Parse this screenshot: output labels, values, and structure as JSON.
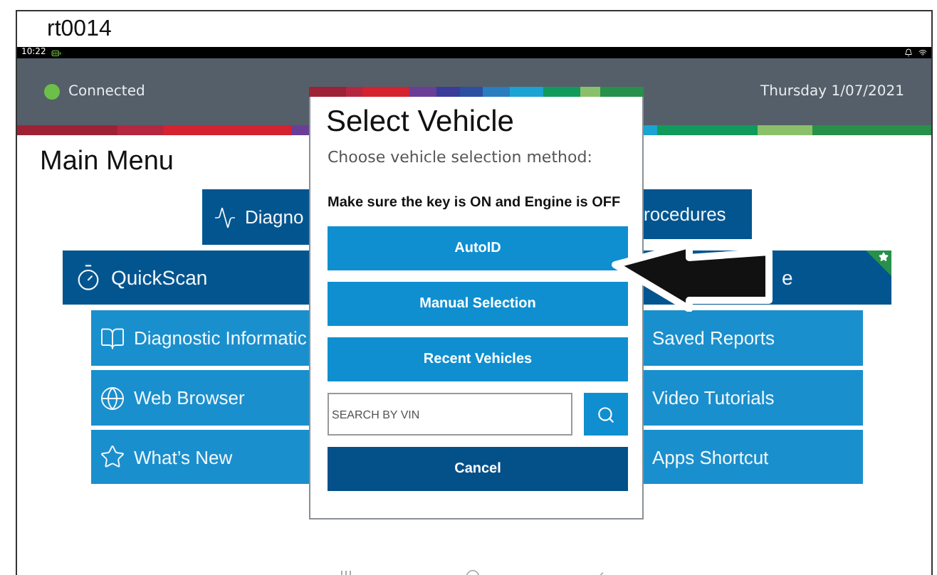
{
  "window": {
    "title": "rt0014"
  },
  "status_bar": {
    "time": "10:22"
  },
  "header": {
    "connection": {
      "label": "Connected",
      "connected": true
    },
    "date": "Thursday 1/07/2021"
  },
  "main_menu": {
    "title": "Main Menu",
    "rows": [
      {
        "tiles": [
          {
            "label": "Diagno",
            "kind": "primary",
            "new": false
          },
          {
            "label": "rocedures",
            "kind": "primary",
            "new": false
          }
        ]
      },
      {
        "tiles": [
          {
            "label": "QuickScan",
            "kind": "primary",
            "new": false
          },
          {
            "label": "e",
            "kind": "primary",
            "new": true
          }
        ]
      },
      {
        "tiles": [
          {
            "label": "Diagnostic Informatic",
            "kind": "secondary",
            "new": false
          },
          {
            "label": "Saved Reports",
            "kind": "secondary",
            "new": false
          }
        ]
      },
      {
        "tiles": [
          {
            "label": "Web Browser",
            "kind": "secondary",
            "new": false
          },
          {
            "label": "Video Tutorials",
            "kind": "secondary",
            "new": false
          }
        ]
      },
      {
        "tiles": [
          {
            "label": "What’s New",
            "kind": "secondary",
            "new": false
          },
          {
            "label": "Apps Shortcut",
            "kind": "secondary",
            "new": false
          }
        ]
      }
    ]
  },
  "dialog": {
    "title": "Select Vehicle",
    "subtitle": "Choose vehicle selection method:",
    "notice": "Make sure the key is ON and Engine is OFF",
    "options": [
      {
        "label": "AutoID"
      },
      {
        "label": "Manual Selection"
      },
      {
        "label": "Recent Vehicles"
      }
    ],
    "search": {
      "placeholder": "SEARCH BY VIN"
    },
    "cancel": {
      "label": "Cancel"
    }
  }
}
